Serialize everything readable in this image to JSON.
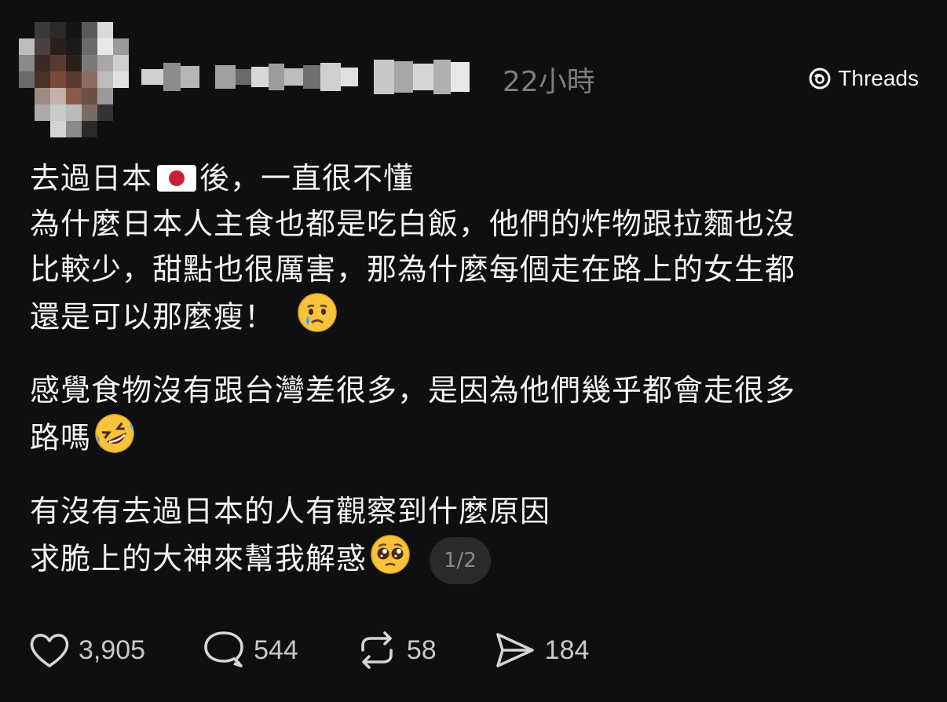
{
  "header": {
    "author_avatar": "blurred-avatar",
    "author_name": "",
    "timestamp": "22小時",
    "brand": {
      "icon": "threads-logo-icon",
      "label": "Threads"
    }
  },
  "post": {
    "paragraphs": [
      {
        "lines": [
          {
            "segments": [
              "去過日本",
              "後，一直很不懂"
            ],
            "flag": "japan-flag"
          },
          {
            "text": "為什麼日本人主食也都是吃白飯，他們的炸物跟拉麵也沒"
          },
          {
            "text": "比較少，甜點也很厲害，那為什麼每個走在路上的女生都"
          },
          {
            "text": "還是可以那麼瘦！",
            "emoji": "crying-face-emoji"
          }
        ]
      },
      {
        "lines": [
          {
            "text": "感覺食物沒有跟台灣差很多，是因為他們幾乎都會走很多"
          },
          {
            "text": "路嗎",
            "emoji": "rolling-on-floor-laughing-emoji"
          }
        ]
      },
      {
        "lines": [
          {
            "text": "有沒有去過日本的人有觀察到什麼原因"
          },
          {
            "text": "求脆上的大神來幫我解惑",
            "emoji": "pleading-face-emoji"
          }
        ]
      }
    ],
    "page_indicator": "1/2"
  },
  "actions": {
    "like": {
      "icon": "heart-icon",
      "count": "3,905"
    },
    "comment": {
      "icon": "comment-bubble-icon",
      "count": "544"
    },
    "repost": {
      "icon": "repost-icon",
      "count": "58"
    },
    "share": {
      "icon": "send-icon",
      "count": "184"
    }
  },
  "colors": {
    "background": "#0f0f0f",
    "text": "#f3f3f3",
    "muted": "#7d7d7d",
    "pill_bg": "#2a2a2a"
  }
}
